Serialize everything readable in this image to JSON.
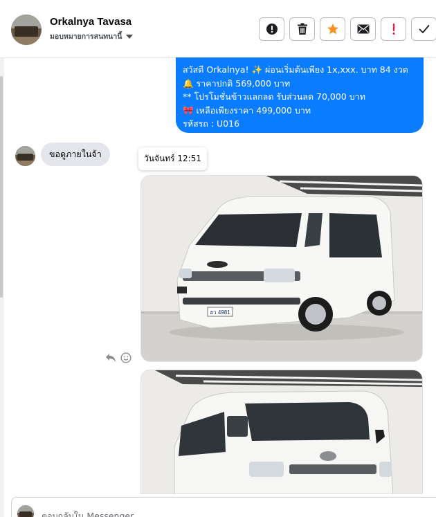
{
  "contact": {
    "name": "Orkalnya Tavasa",
    "assign_label": "มอบหมายการสนทนานี้"
  },
  "actions": {
    "report": "report-icon",
    "delete": "trash-icon",
    "star": "star-icon",
    "mark_unread": "envelope-icon",
    "important": "exclamation-icon",
    "done": "check-icon",
    "star_color": "#f7931e",
    "important_color": "#e41e3f"
  },
  "messages": {
    "outgoing": {
      "lines": [
        "สวัสดี Orkalnya! ✨  ผ่อนเริ่มต้นเพียง 1x,xxx. บาท 84 งวด",
        "🔔 ราคาปกติ 569,000 บาท",
        "** โปรโมชั่นข้าวแลกลด รับส่วนลด 70,000 บาท",
        "🎀  เหลือเพียงราคา 499,000 บาท",
        " รหัสรถ : U016"
      ]
    },
    "incoming": {
      "text": "ขอดูภายในจ้า"
    },
    "tooltip": "วันจันทร์ 12:51",
    "photo1_plate": "ฮว 4981"
  },
  "composer": {
    "placeholder": "ตอบกลับใน Messenger"
  },
  "colors": {
    "outgoing_bubble": "#0a7cff",
    "incoming_bubble": "#e4e6eb"
  }
}
